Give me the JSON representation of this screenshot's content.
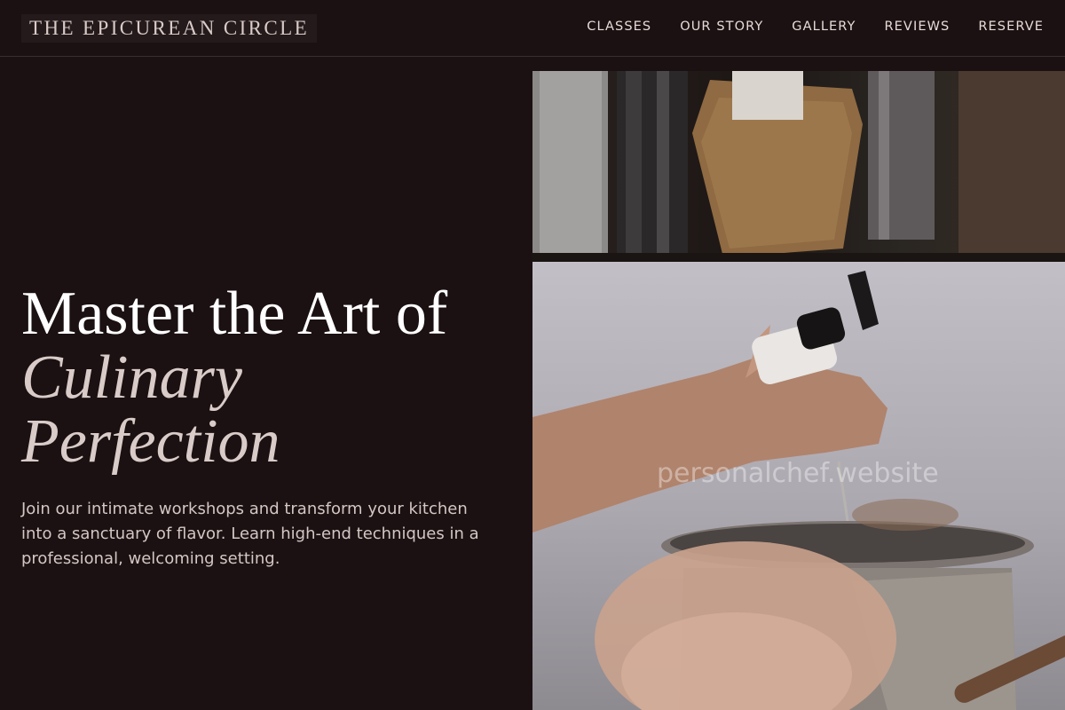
{
  "brand": {
    "name": "THE EPICUREAN CIRCLE"
  },
  "nav": {
    "items": [
      {
        "label": "CLASSES"
      },
      {
        "label": "OUR STORY"
      },
      {
        "label": "GALLERY"
      },
      {
        "label": "REVIEWS"
      },
      {
        "label": "RESERVE"
      }
    ]
  },
  "hero": {
    "title_line1": "Master the Art of",
    "title_line2": "Culinary",
    "title_line3": "Perfection",
    "description": "Join our intimate workshops and transform your kitchen into a sanctuary of flavor. Learn high-end techniques in a professional, welcoming setting.",
    "image_watermark": "personalchef.website"
  },
  "colors": {
    "background": "#1b1112",
    "accent_text": "#d9cbc8",
    "body_text": "#d4c7c4"
  }
}
